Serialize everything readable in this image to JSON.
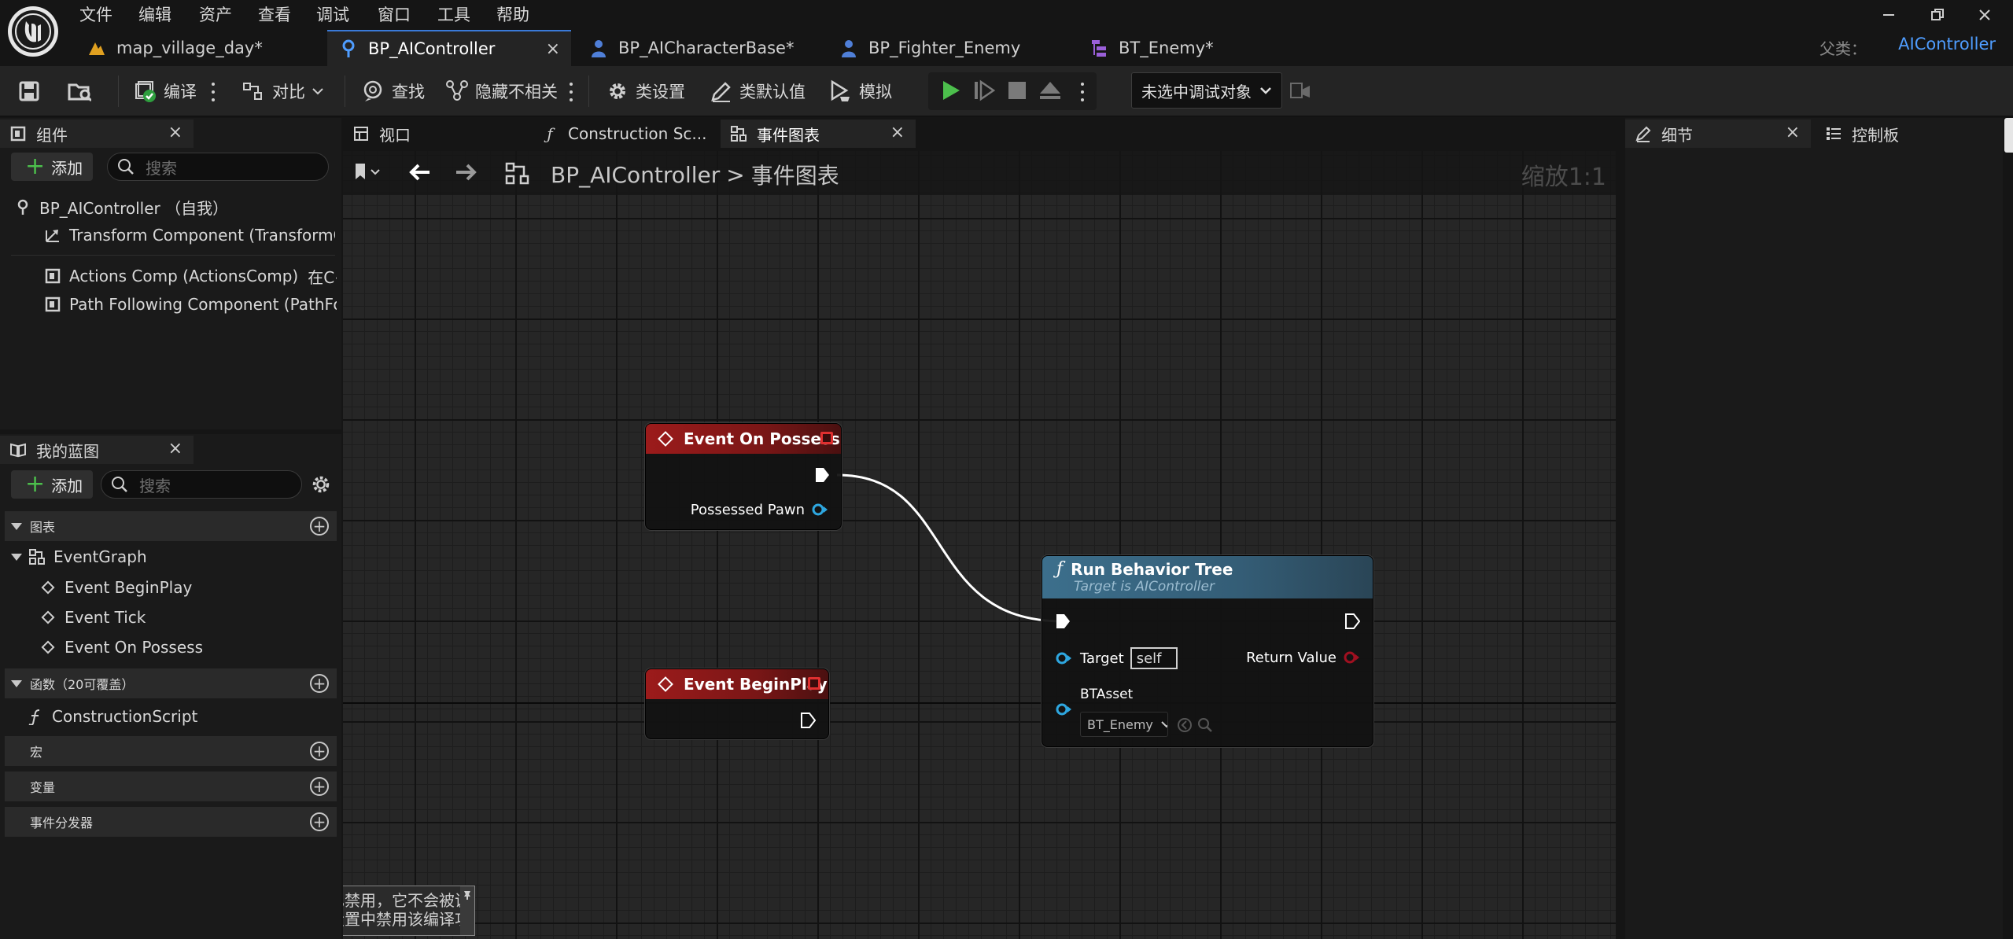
{
  "menu": [
    "文件",
    "编辑",
    "资产",
    "查看",
    "调试",
    "窗口",
    "工具",
    "帮助"
  ],
  "tabs": [
    {
      "label": "map_village_day*",
      "icon": "level-icon"
    },
    {
      "label": "BP_AIController",
      "icon": "controller-blueprint-icon",
      "active": true
    },
    {
      "label": "BP_AICharacterBase*",
      "icon": "character-icon"
    },
    {
      "label": "BP_Fighter_Enemy",
      "icon": "character-icon"
    },
    {
      "label": "BT_Enemy*",
      "icon": "behavior-tree-icon"
    }
  ],
  "parent": {
    "label": "父类：",
    "value": "AIController"
  },
  "toolbar": {
    "compile": "编译",
    "diff": "对比",
    "find": "查找",
    "hide_unrelated": "隐藏不相关",
    "class_settings": "类设置",
    "class_defaults": "类默认值",
    "simulate": "模拟",
    "debug_target": "未选中调试对象"
  },
  "components": {
    "tab": "组件",
    "add": "添加",
    "search_placeholder": "搜索",
    "root": "BP_AIController （自我）",
    "items": [
      "Transform Component (TransformComponent)",
      "Actions Comp (ActionsComp)",
      "Path Following Component (PathFollowingComponent)"
    ],
    "inherited_note": "在C++中继承"
  },
  "my_blueprint": {
    "tab": "我的蓝图",
    "add": "添加",
    "search_placeholder": "搜索",
    "graphs_section": "图表",
    "event_graph": "EventGraph",
    "events": [
      "Event BeginPlay",
      "Event Tick",
      "Event On Possess"
    ],
    "functions_section": "函数（20可覆盖）",
    "construction_script": "ConstructionScript",
    "macros_section": "宏",
    "variables_section": "变量",
    "dispatchers_section": "事件分发器"
  },
  "editor_tabs": [
    "视口",
    "Construction Sc...",
    "事件图表"
  ],
  "right_tabs": [
    "细节",
    "控制板"
  ],
  "breadcrumb": {
    "root": "BP_AIController",
    "separator": ">",
    "current": "事件图表"
  },
  "zoom": "缩放1:1",
  "nodes": {
    "on_possess": {
      "title": "Event On Possess",
      "pin": "Possessed Pawn"
    },
    "begin_play": {
      "title": "Event BeginPlay"
    },
    "run_bt": {
      "title": "Run Behavior Tree",
      "subtitle": "Target is AIController",
      "target_label": "Target",
      "target_value": "self",
      "return_label": "Return Value",
      "asset_label": "BTAsset",
      "asset_value": "BT_Enemy"
    }
  },
  "comment_text": [
    "节点已禁用，它不会被调用。",
    "可在设置中禁用该编译功能。"
  ],
  "colors": {
    "accent_blue": "#4f9dff",
    "event_red": "#9c1b1b",
    "function_blue": "#3c6f8c",
    "object_pin": "#2ea7e0",
    "play_green": "#4cbf4c"
  }
}
